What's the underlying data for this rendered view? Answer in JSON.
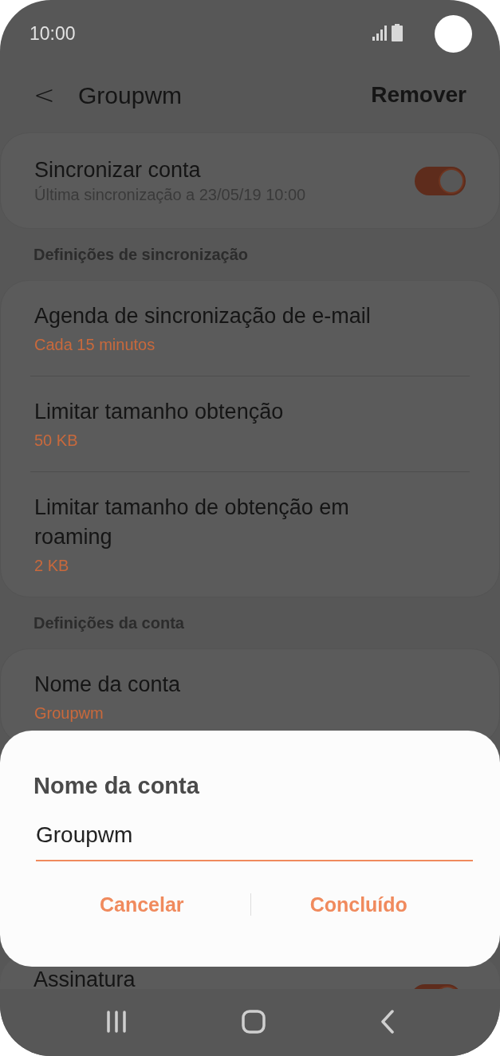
{
  "status_bar": {
    "time": "10:00"
  },
  "header": {
    "back": "<",
    "title": "Groupwm",
    "action": "Remover"
  },
  "sync_card": {
    "title": "Sincronizar conta",
    "subtitle": "Última sincronização a 23/05/19  10:00",
    "on": true
  },
  "sections": [
    {
      "title": "Definições de sincronização",
      "items": [
        {
          "title": "Agenda de sincronização de e-mail",
          "value": "Cada 15 minutos"
        },
        {
          "title": "Limitar tamanho obtenção",
          "value": "50 KB"
        },
        {
          "title": "Limitar tamanho de obtenção em roaming",
          "value": "2 KB"
        }
      ]
    },
    {
      "title": "Definições da conta",
      "items": [
        {
          "title": "Nome da conta",
          "value": "Groupwm"
        }
      ]
    }
  ],
  "signature_row": {
    "title": "Assinatura",
    "on": true
  },
  "dialog": {
    "title": "Nome da conta",
    "value": "Groupwm",
    "buttons": [
      "Cancelar",
      "Concluído"
    ]
  }
}
